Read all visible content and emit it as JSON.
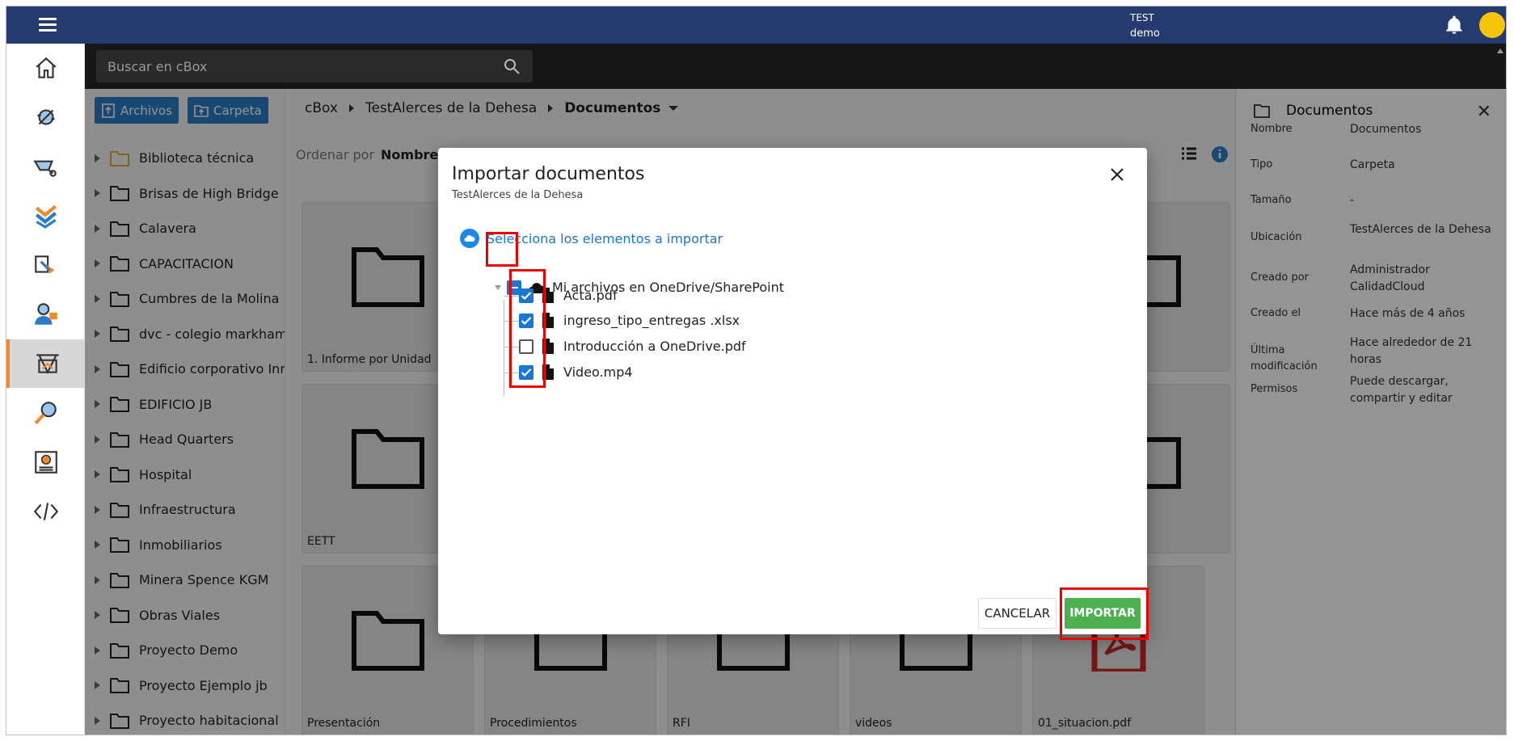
{
  "topbar": {
    "user_line1": "TEST",
    "user_line2": "demo"
  },
  "search": {
    "placeholder": "Buscar en cBox"
  },
  "tree": {
    "btn_files": "Archivos",
    "btn_folder": "Carpeta",
    "items": [
      "Biblioteca técnica",
      "Brisas de High Bridge",
      "Calavera",
      "CAPACITACION",
      "Cumbres de la Molina",
      "dvc - colegio markham",
      "Edificio corporativo Inn",
      "EDIFICIO JB",
      "Head Quarters",
      "Hospital",
      "Infraestructura",
      "Inmobiliarios",
      "Minera Spence KGM",
      "Obras Viales",
      "Proyecto Demo",
      "Proyecto Ejemplo jb",
      "Proyecto habitacional"
    ]
  },
  "breadcrumb": {
    "c1": "cBox",
    "c2": "TestAlerces de la Dehesa",
    "c3": "Documentos"
  },
  "sort": {
    "label": "Ordenar por",
    "value": "Nombre"
  },
  "tiles": {
    "t1": "1. Informe por Unidad",
    "t2": "EETT",
    "t3": "Presentación",
    "t4": "Procedimientos",
    "t5": "RFI",
    "t6": "videos",
    "t7": "01_situacion.pdf"
  },
  "details": {
    "title": "Documentos",
    "rows": [
      {
        "k": "Nombre",
        "v": "Documentos"
      },
      {
        "k": "Tipo",
        "v": "Carpeta"
      },
      {
        "k": "Tamaño",
        "v": "-"
      },
      {
        "k": "Ubicación",
        "v": "TestAlerces de la Dehesa"
      },
      {
        "k": "Creado por",
        "v": "Administrador CalidadCloud"
      },
      {
        "k": "Creado el",
        "v": "Hace más de 4 años"
      },
      {
        "k": "Última modificación",
        "v": "Hace alrededor de 21 horas"
      },
      {
        "k": "Permisos",
        "v": "Puede descargar, compartir y editar"
      }
    ]
  },
  "modal": {
    "title": "Importar documentos",
    "subtitle": "TestAlerces de la Dehesa",
    "section": "Selecciona los elementos a importar",
    "root": "Mi archivos en OneDrive/SharePoint",
    "files": [
      {
        "name": "Acta.pdf",
        "checked": true
      },
      {
        "name": "ingreso_tipo_entregas .xlsx",
        "checked": true
      },
      {
        "name": "Introducción a OneDrive.pdf",
        "checked": false
      },
      {
        "name": "Video.mp4",
        "checked": true
      }
    ],
    "cancel": "CANCELAR",
    "import": "IMPORTAR"
  },
  "colors": {
    "header": "#253a6e",
    "accent": "#2b7cc7",
    "import": "#4caf50",
    "highlight": "#e00000"
  }
}
